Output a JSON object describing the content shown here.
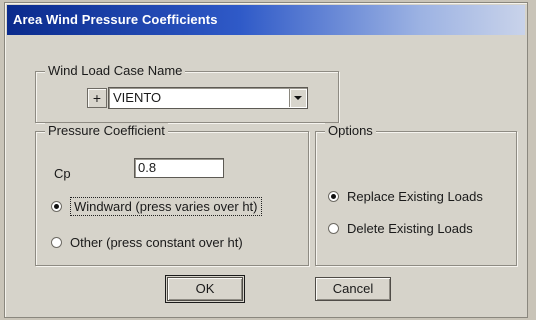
{
  "window": {
    "title": "Area Wind Pressure Coefficients"
  },
  "wind_load_case": {
    "group_label": "Wind Load Case Name",
    "add_button": "+",
    "selected_value": "VIENTO"
  },
  "pressure_coefficient": {
    "group_label": "Pressure Coefficient",
    "cp_label": "Cp",
    "cp_value": "0.8",
    "options": [
      {
        "label": "Windward (press varies over ht)",
        "selected": true
      },
      {
        "label": "Other (press constant over ht)",
        "selected": false
      }
    ]
  },
  "options_group": {
    "group_label": "Options",
    "choices": [
      {
        "label": "Replace Existing Loads",
        "selected": true
      },
      {
        "label": "Delete Existing Loads",
        "selected": false
      }
    ]
  },
  "buttons": {
    "ok": "OK",
    "cancel": "Cancel"
  }
}
